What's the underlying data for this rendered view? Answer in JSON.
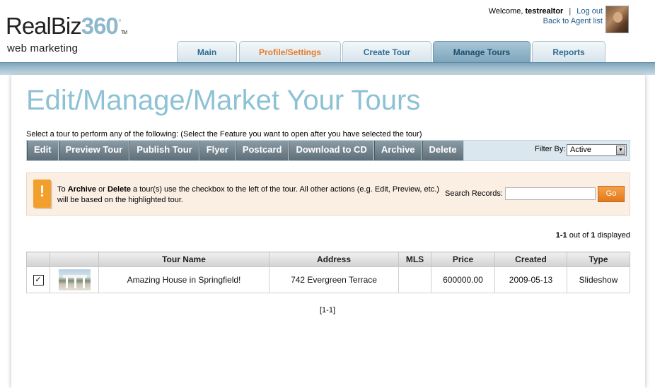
{
  "logo": {
    "brand_a": "RealBiz",
    "brand_b": "360",
    "deg": "°",
    "tm": "TM",
    "sub": "web marketing"
  },
  "user": {
    "welcome": "Welcome,",
    "name": "testrealtor",
    "sep": "|",
    "logout": "Log out",
    "back": "Back to Agent list"
  },
  "nav": {
    "tabs": [
      "Main",
      "Profile/Settings",
      "Create Tour",
      "Manage Tours",
      "Reports"
    ],
    "active": "Manage Tours"
  },
  "page": {
    "title": "Edit/Manage/Market Your Tours",
    "instructions": "Select a tour to perform any of the following: (Select the Feature you want to open after you have selected the tour)"
  },
  "actions": [
    "Edit",
    "Preview Tour",
    "Publish Tour",
    "Flyer",
    "Postcard",
    "Download to CD",
    "Archive",
    "Delete"
  ],
  "filter": {
    "label": "Filter By:",
    "value": "Active"
  },
  "notice": {
    "pre": "To ",
    "archive": "Archive",
    "mid": " or ",
    "delete": "Delete",
    "post": " a tour(s) use the checkbox to the left of the tour. All other actions (e.g. Edit, Preview, etc.) will be based on the highlighted tour.",
    "icon": "!"
  },
  "search": {
    "label": "Search Records:",
    "value": "",
    "button": "Go"
  },
  "count": {
    "range": "1-1",
    "mid": " out of ",
    "total": "1",
    "suffix": " displayed"
  },
  "table": {
    "headers": [
      "",
      "",
      "Tour Name",
      "Address",
      "MLS",
      "Price",
      "Created",
      "Type"
    ],
    "rows": [
      {
        "checked": "✓",
        "name": "Amazing House in Springfield!",
        "address": "742 Evergreen Terrace",
        "mls": "",
        "price": "600000.00",
        "created": "2009-05-13",
        "type": "Slideshow"
      }
    ]
  },
  "pager": "[1-1]",
  "colors": {
    "title": "#8dc2d4",
    "link": "#1f5b8c",
    "orange": "#e87a28",
    "go": "#e3791a"
  }
}
